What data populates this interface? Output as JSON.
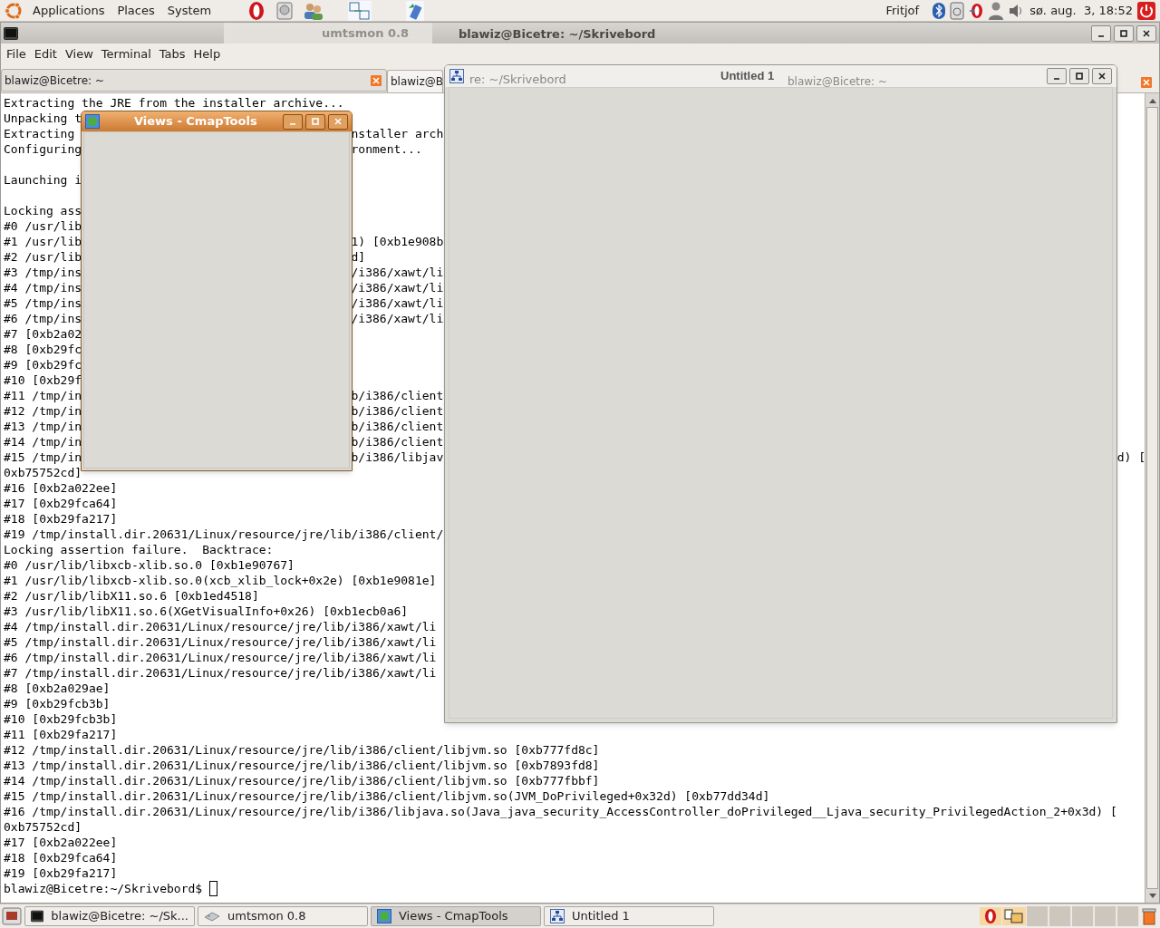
{
  "top_panel": {
    "menus": [
      "Applications",
      "Places",
      "System"
    ],
    "user": "Fritjof",
    "clock": "sø. aug.  3, 18:52"
  },
  "terminal_window": {
    "ghost_title": "umtsmon 0.8",
    "title": "blawiz@Bicetre: ~/Skrivebord",
    "menu": [
      "File",
      "Edit",
      "View",
      "Terminal",
      "Tabs",
      "Help"
    ],
    "tabs": [
      {
        "label": "blawiz@Bicetre: ~",
        "selected": false
      },
      {
        "label": "blawiz@B",
        "selected": true
      }
    ],
    "lines": [
      {
        "text": "Extracting the JRE from the installer archive..."
      },
      {
        "text": "Unpacking t"
      },
      {
        "text": "Extracting",
        "right": "nstaller arch"
      },
      {
        "text": "Configuring",
        "right": "ronment..."
      },
      {
        "kind": "blank"
      },
      {
        "text": "Launching i"
      },
      {
        "kind": "blank"
      },
      {
        "text": "Locking ass"
      },
      {
        "text": "#0 /usr/lib"
      },
      {
        "text": "#1 /usr/lib",
        "right": "1) [0xb1e908b"
      },
      {
        "text": "#2 /usr/lib",
        "right": "d]"
      },
      {
        "text": "#3 /tmp/ins",
        "right": "/i386/xawt/li"
      },
      {
        "text": "#4 /tmp/ins",
        "right": "/i386/xawt/li"
      },
      {
        "text": "#5 /tmp/ins",
        "right": "/i386/xawt/li"
      },
      {
        "text": "#6 /tmp/ins",
        "right": "/i386/xawt/li"
      },
      {
        "text": "#7 [0xb2a02"
      },
      {
        "text": "#8 [0xb29fc"
      },
      {
        "text": "#9 [0xb29fc"
      },
      {
        "text": "#10 [0xb29f"
      },
      {
        "text": "#11 /tmp/in",
        "right": "b/i386/client"
      },
      {
        "text": "#12 /tmp/in",
        "right": "b/i386/client"
      },
      {
        "text": "#13 /tmp/in",
        "right": "b/i386/client"
      },
      {
        "text": "#14 /tmp/in",
        "right": "b/i386/client"
      },
      {
        "text": "#15 /tmp/in",
        "right": "b/i386/libjav",
        "far": "d) ["
      },
      {
        "text": "0xb75752cd]"
      },
      {
        "text": "#16 [0xb2a022ee]"
      },
      {
        "text": "#17 [0xb29fca64]"
      },
      {
        "text": "#18 [0xb29fa217]"
      },
      {
        "text": "#19 /tmp/install.dir.20631/Linux/resource/jre/lib/i386/client/"
      },
      {
        "text": "Locking assertion failure.  Backtrace:"
      },
      {
        "text": "#0 /usr/lib/libxcb-xlib.so.0 [0xb1e90767]"
      },
      {
        "text": "#1 /usr/lib/libxcb-xlib.so.0(xcb_xlib_lock+0x2e) [0xb1e9081e]"
      },
      {
        "text": "#2 /usr/lib/libX11.so.6 [0xb1ed4518]"
      },
      {
        "text": "#3 /usr/lib/libX11.so.6(XGetVisualInfo+0x26) [0xb1ecb0a6]"
      },
      {
        "text": "#4 /tmp/install.dir.20631/Linux/resource/jre/lib/i386/xawt/li"
      },
      {
        "text": "#5 /tmp/install.dir.20631/Linux/resource/jre/lib/i386/xawt/li"
      },
      {
        "text": "#6 /tmp/install.dir.20631/Linux/resource/jre/lib/i386/xawt/li"
      },
      {
        "text": "#7 /tmp/install.dir.20631/Linux/resource/jre/lib/i386/xawt/li"
      },
      {
        "text": "#8 [0xb2a029ae]"
      },
      {
        "text": "#9 [0xb29fcb3b]"
      },
      {
        "text": "#10 [0xb29fcb3b]"
      },
      {
        "text": "#11 [0xb29fa217]"
      },
      {
        "text": "#12 /tmp/install.dir.20631/Linux/resource/jre/lib/i386/client/libjvm.so [0xb777fd8c]"
      },
      {
        "text": "#13 /tmp/install.dir.20631/Linux/resource/jre/lib/i386/client/libjvm.so [0xb7893fd8]"
      },
      {
        "text": "#14 /tmp/install.dir.20631/Linux/resource/jre/lib/i386/client/libjvm.so [0xb777fbbf]"
      },
      {
        "text": "#15 /tmp/install.dir.20631/Linux/resource/jre/lib/i386/client/libjvm.so(JVM_DoPrivileged+0x32d) [0xb77dd34d]"
      },
      {
        "text": "#16 /tmp/install.dir.20631/Linux/resource/jre/lib/i386/libjava.so(Java_java_security_AccessController_doPrivileged__Ljava_security_PrivilegedAction_2+0x3d) ["
      },
      {
        "text": "0xb75752cd]"
      },
      {
        "text": "#17 [0xb2a022ee]"
      },
      {
        "text": "#18 [0xb29fca64]"
      },
      {
        "text": "#19 [0xb29fa217]"
      },
      {
        "kind": "prompt",
        "text": "blawiz@Bicetre:~/Skrivebord$ "
      }
    ]
  },
  "views_window": {
    "title": "Views - CmapTools"
  },
  "untitled_window": {
    "title": "Untitled 1",
    "ghost_texts": [
      "re: ~/Skrivebord",
      "blawiz@Bicetre: ~"
    ]
  },
  "taskbar": {
    "items": [
      {
        "kind": "terminal",
        "label": "blawiz@Bicetre: ~/Sk...",
        "selected": false
      },
      {
        "kind": "modem",
        "label": "umtsmon 0.8",
        "selected": false
      },
      {
        "kind": "cmap",
        "label": "Views - CmapTools",
        "selected": true
      },
      {
        "kind": "diagram",
        "label": "Untitled 1",
        "selected": false
      }
    ]
  }
}
